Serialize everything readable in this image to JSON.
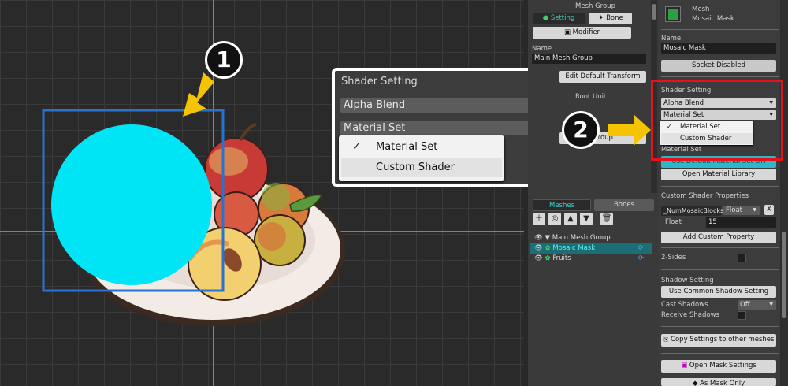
{
  "callout_numbers": {
    "one": "1",
    "two": "2"
  },
  "viewport": {},
  "callout": {
    "title": "Shader Setting",
    "blend_value": "Alpha Blend",
    "material_value": "Material Set",
    "options": [
      "Material Set",
      "Custom Shader"
    ],
    "checkmark": "✓"
  },
  "middle_panel": {
    "header": "Mesh Group",
    "tab_setting": "Setting",
    "tab_bone": "Bone",
    "modifier": "Modifier",
    "name_label": "Name",
    "name_value": "Main Mesh Group",
    "edit_default_transform": "Edit Default Transform",
    "root_unit": "Root Unit",
    "hidden_btn_tail": "Group",
    "tabs": {
      "meshes": "Meshes",
      "bones": "Bones"
    },
    "tree": [
      {
        "label": "Main Mesh Group",
        "arrow": "▼"
      },
      {
        "label": "Mosaic Mask"
      },
      {
        "label": "Fruits"
      }
    ]
  },
  "right_panel": {
    "mesh_type": "Mesh",
    "mesh_name": "Mosaic Mask",
    "name_label": "Name",
    "name_value": "Mosaic Mask",
    "socket": "Socket Disabled",
    "shader_setting": "Shader Setting",
    "blend_value": "Alpha Blend",
    "material_value": "Material Set",
    "menu_options": [
      "Material Set",
      "Custom Shader"
    ],
    "material_set_label": "Material Set",
    "use_default_material": "Use Default Material Set ON",
    "open_material_library": "Open Material Library",
    "custom_shader_properties": "Custom Shader Properties",
    "property_name": "_NumMosaicBlocks",
    "property_type": "Float",
    "property_remove": "X",
    "float_label": "Float",
    "float_value": "15",
    "add_custom_property": "Add Custom Property",
    "two_sides": "2-Sides",
    "shadow_setting": "Shadow Setting",
    "use_common_shadow": "Use Common Shadow Setting",
    "cast_shadows": "Cast Shadows",
    "cast_shadows_value": "Off",
    "receive_shadows": "Receive Shadows",
    "copy_settings": "Copy Settings to other meshes",
    "open_mask_settings": "Open Mask Settings",
    "as_mask_only": "As Mask Only"
  },
  "colors": {
    "accent_cyan": "#00e5f5",
    "selection_blue": "#2a72d0",
    "highlight_red": "#e8101a",
    "arrow_yellow": "#f5c400"
  }
}
